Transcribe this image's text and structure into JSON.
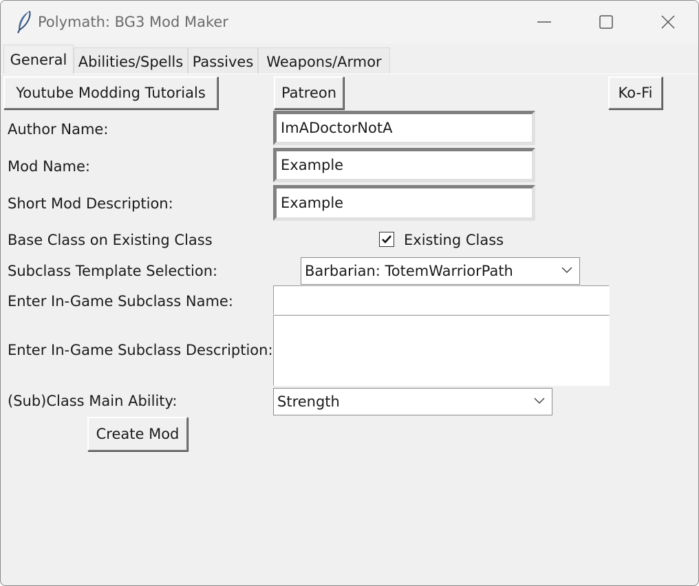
{
  "window": {
    "title": "Polymath: BG3 Mod Maker",
    "icons": {
      "app": "feather-icon",
      "minimize": "minimize-icon",
      "maximize": "maximize-icon",
      "close": "close-icon"
    }
  },
  "tabs": [
    {
      "label": "General",
      "active": true
    },
    {
      "label": "Abilities/Spells",
      "active": false
    },
    {
      "label": "Passives",
      "active": false
    },
    {
      "label": "Weapons/Armor",
      "active": false
    }
  ],
  "links": {
    "youtube": "Youtube Modding Tutorials",
    "patreon": "Patreon",
    "kofi": "Ko-Fi"
  },
  "form": {
    "author_label": "Author Name:",
    "author_value": "ImADoctorNotA",
    "mod_name_label": "Mod Name:",
    "mod_name_value": "Example",
    "short_desc_label": "Short Mod Description:",
    "short_desc_value": "Example",
    "base_class_label": "Base Class on Existing Class",
    "existing_class_checkbox_label": "Existing Class",
    "existing_class_checked": true,
    "subclass_template_label": "Subclass Template Selection:",
    "subclass_template_value": "Barbarian: TotemWarriorPath",
    "subclass_name_label": "Enter In-Game Subclass Name:",
    "subclass_name_value": "",
    "subclass_desc_label": "Enter In-Game Subclass Description:",
    "subclass_desc_value": "",
    "main_ability_label": "(Sub)Class Main Ability:",
    "main_ability_value": "Strength",
    "create_button": "Create Mod"
  }
}
